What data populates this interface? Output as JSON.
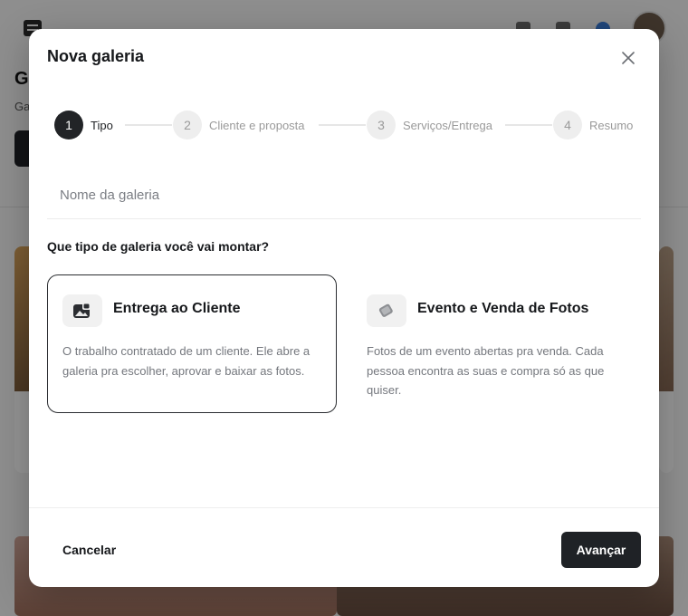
{
  "background": {
    "page_title": "G",
    "page_subtitle": "Ga"
  },
  "modal": {
    "title": "Nova galeria",
    "close_icon": "close-icon"
  },
  "stepper": {
    "steps": [
      {
        "number": "1",
        "label": "Tipo",
        "active": true
      },
      {
        "number": "2",
        "label": "Cliente e proposta",
        "active": false
      },
      {
        "number": "3",
        "label": "Serviços/Entrega",
        "active": false
      },
      {
        "number": "4",
        "label": "Resumo",
        "active": false
      }
    ]
  },
  "name_field": {
    "value": "",
    "placeholder": "Nome da galeria"
  },
  "question": "Que tipo de galeria você vai montar?",
  "options": [
    {
      "icon": "photo-delivery-icon",
      "title": "Entrega ao Cliente",
      "description": "O trabalho contratado de um cliente. Ele abre a galeria pra escolher, aprovar e baixar as fotos.",
      "selected": true
    },
    {
      "icon": "event-photos-icon",
      "title": "Evento e Venda de Fotos",
      "description": "Fotos de um evento abertas pra venda. Cada pessoa encontra as suas e compra só as que quiser.",
      "selected": false
    }
  ],
  "footer": {
    "cancel_label": "Cancelar",
    "next_label": "Avançar"
  },
  "colors": {
    "primary_dark": "#1f2226",
    "muted_text": "#74777d",
    "selected_border": "#2a2c30"
  }
}
